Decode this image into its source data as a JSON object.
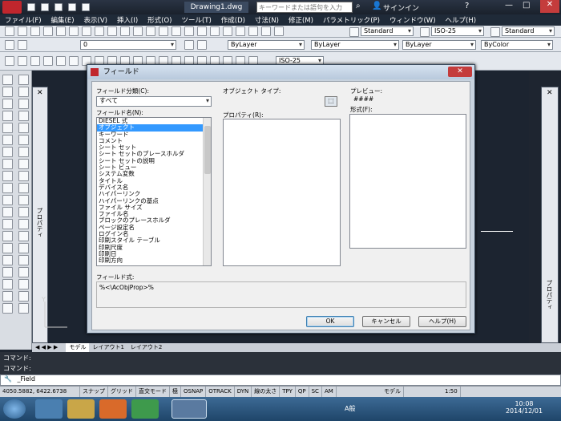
{
  "app": {
    "title": "Drawing1.dwg",
    "search_placeholder": "キーワードまたは語句を入力",
    "signin": "サインイン"
  },
  "menu": [
    "ファイル(F)",
    "編集(E)",
    "表示(V)",
    "挿入(I)",
    "形式(O)",
    "ツール(T)",
    "作成(D)",
    "寸法(N)",
    "修正(M)",
    "パラメトリック(P)",
    "ウィンドウ(W)",
    "ヘルプ(H)"
  ],
  "toolbar": {
    "textstyle": "Standard",
    "dimstyle": "ISO-25",
    "tablestyle": "Standard",
    "layer": "0",
    "color": "ByLayer",
    "linetype": "ByLayer",
    "lineweight": "ByLayer",
    "plotstyle": "ByColor",
    "dim2": "ISO-25"
  },
  "palette": {
    "left_label": "プロパティ",
    "right_label": "プロパティ"
  },
  "dialog": {
    "title": "フィールド",
    "category_label": "フィールド分類(C):",
    "category_value": "すべて",
    "fieldnames_label": "フィールド名(N):",
    "fieldnames": [
      "DIESEL 式",
      "オブジェクト",
      "キーワード",
      "コメント",
      "シート セット",
      "シート セットのプレースホルダ",
      "シート セットの説明",
      "シート ビュー",
      "システム変数",
      "タイトル",
      "デバイス名",
      "ハイパーリンク",
      "ハイパーリンクの基点",
      "ファイル サイズ",
      "ファイル名",
      "ブロックのプレースホルダ",
      "ページ設定名",
      "ログイン名",
      "印刷スタイル テーブル",
      "印刷尺度",
      "印刷日",
      "印刷方向"
    ],
    "selected_index": 1,
    "objtype_label": "オブジェクト タイプ:",
    "props_label": "プロパティ(R):",
    "preview_label": "プレビュー:",
    "preview_value": "####",
    "format_label": "形式(F):",
    "expr_label": "フィールド式:",
    "expr_value": "%<\\AcObjProp>%",
    "ok": "OK",
    "cancel": "キャンセル",
    "help": "ヘルプ(H)"
  },
  "tabs": [
    "モデル",
    "レイアウト1",
    "レイアウト2"
  ],
  "command": {
    "line1": "コマンド:",
    "line2": "コマンド:",
    "input": "_Field"
  },
  "status": {
    "coords": "4050.5882, 6422.6738",
    "buttons": [
      "スナップ",
      "グリッド",
      "直交モード",
      "極",
      "OSNAP",
      "OTRACK",
      "DYN",
      "線の太さ",
      "TPY",
      "QP",
      "SC",
      "AM"
    ],
    "model": "モデル",
    "scale": "1:50"
  },
  "taskbar": {
    "time": "10:08",
    "date": "2014/12/01",
    "ime": "A般"
  }
}
